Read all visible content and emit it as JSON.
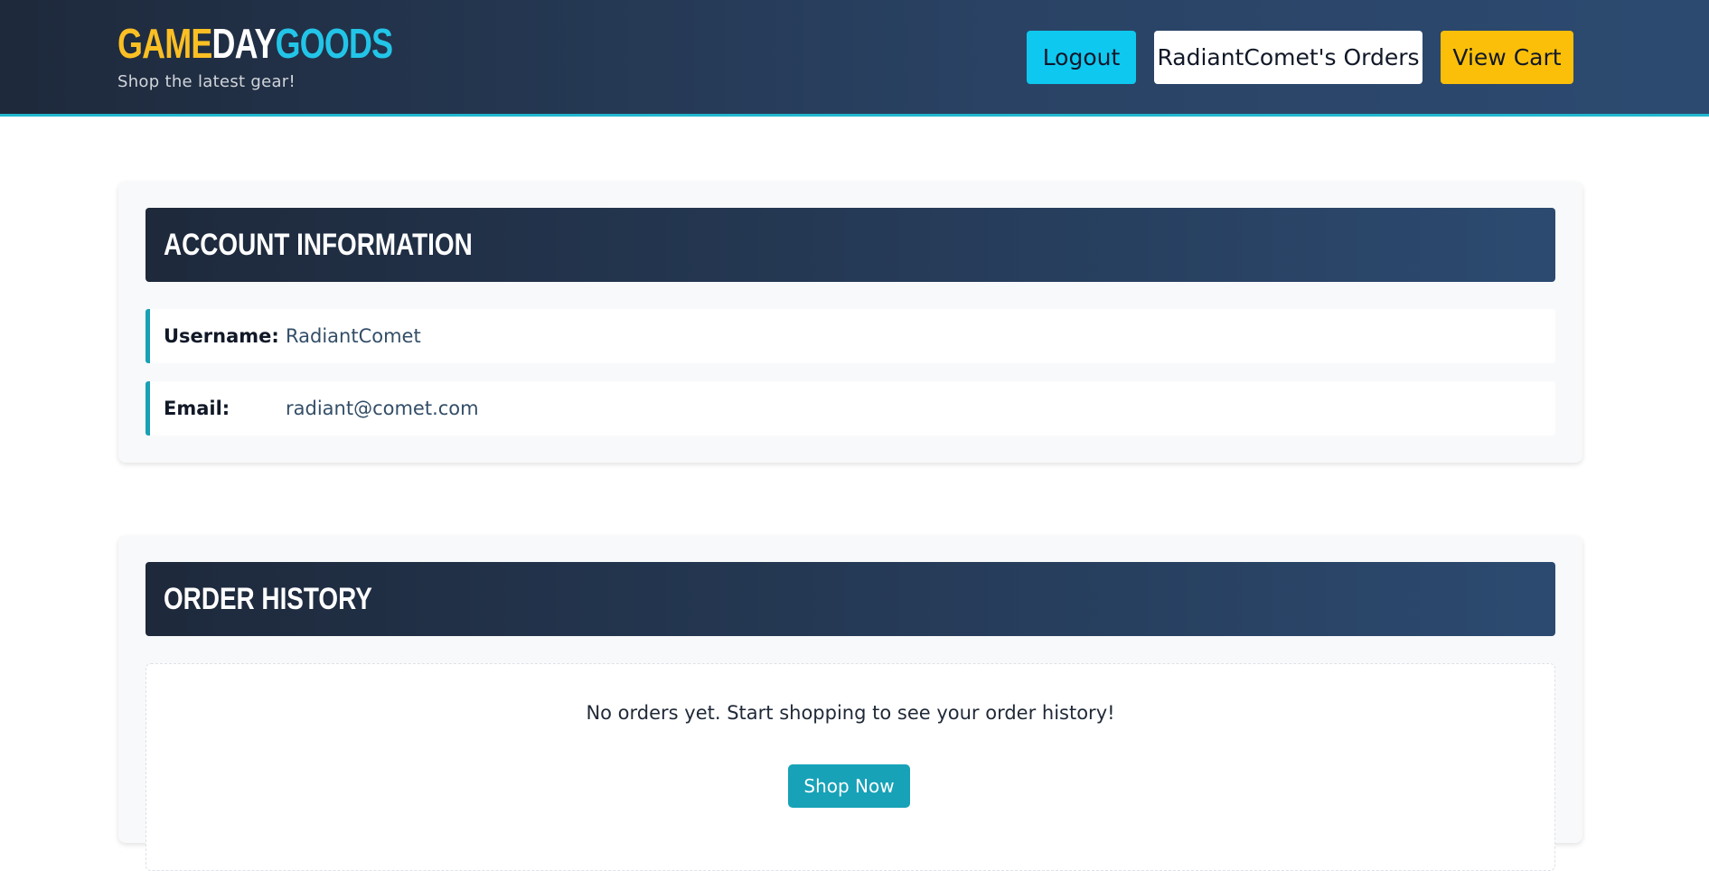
{
  "header": {
    "logo": {
      "part1": "GAME",
      "part2": "DAY",
      "part3": "GOODS"
    },
    "tagline": "Shop the latest gear!",
    "nav": {
      "logout": "Logout",
      "orders": "RadiantComet's Orders",
      "cart": "View Cart"
    }
  },
  "account": {
    "title": "ACCOUNT INFORMATION",
    "username_label": "Username:",
    "username_value": "RadiantComet",
    "email_label": "Email:",
    "email_value": "radiant@comet.com"
  },
  "orders": {
    "title": "ORDER HISTORY",
    "empty_message": "No orders yet. Start shopping to see your order history!",
    "shop_button": "Shop Now"
  },
  "colors": {
    "header_bg": "#1e293b",
    "accent_yellow": "#fbbf24",
    "accent_cyan": "#22c5e8",
    "teal": "#17a2b8"
  }
}
